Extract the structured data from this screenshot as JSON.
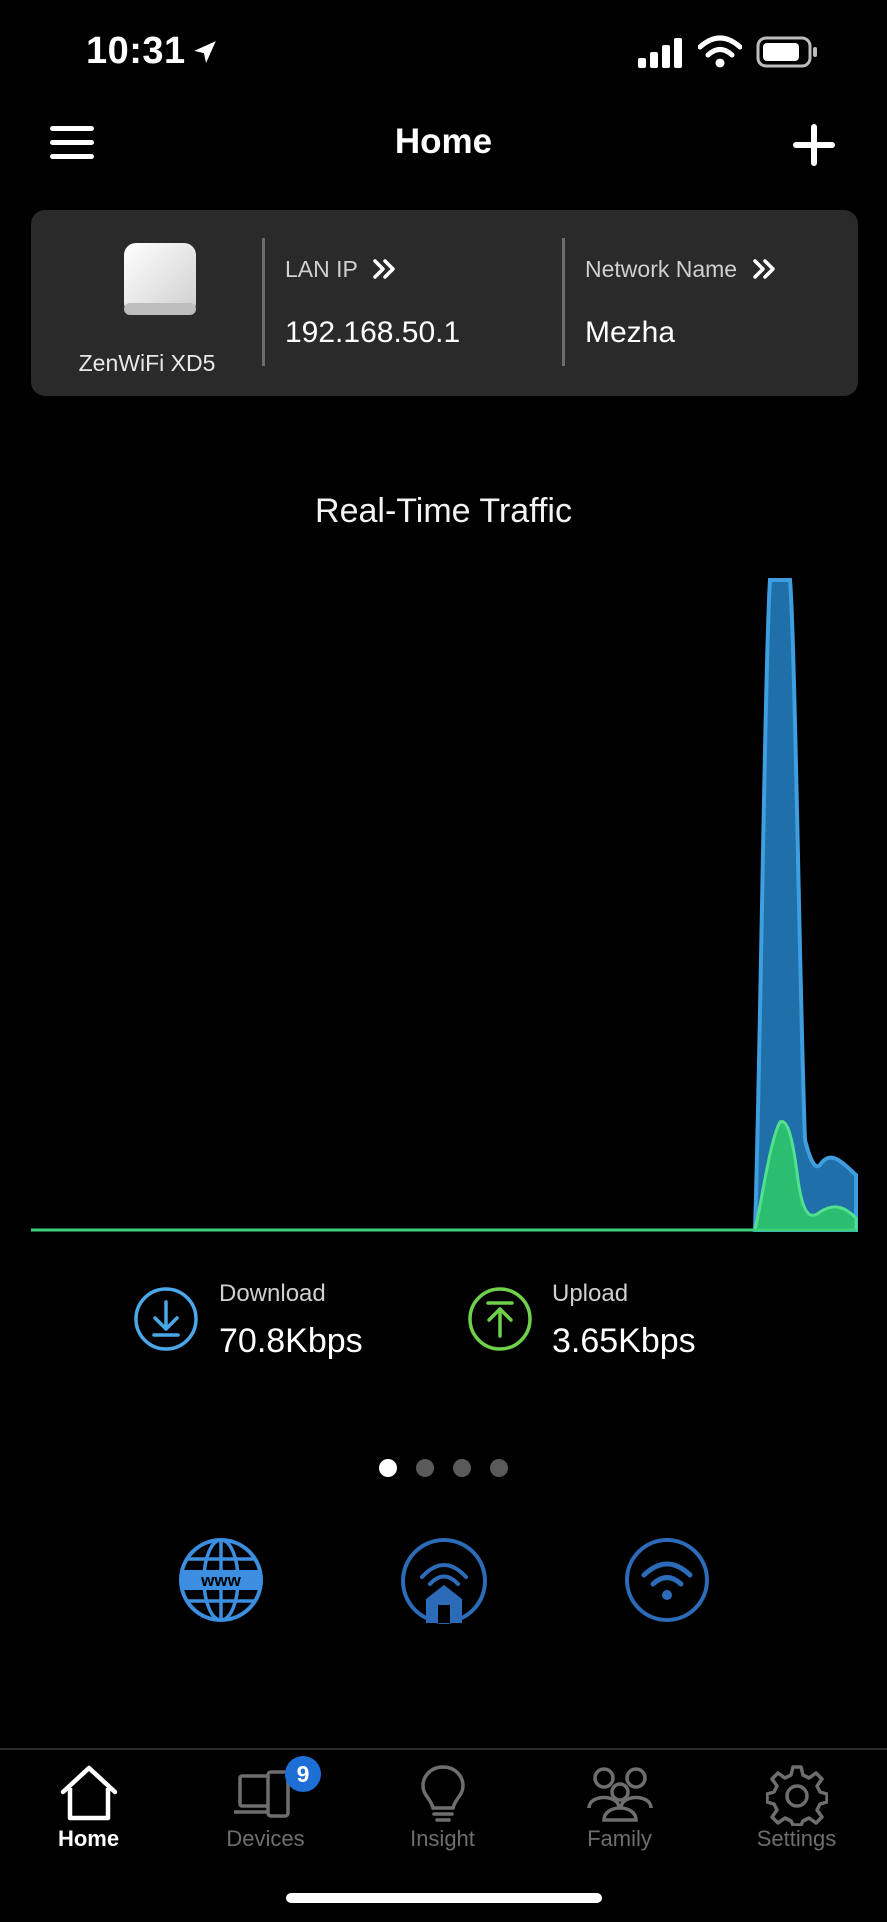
{
  "status_bar": {
    "time": "10:31"
  },
  "header": {
    "title": "Home"
  },
  "router": {
    "model": "ZenWiFi XD5",
    "lan_ip_label": "LAN IP",
    "lan_ip": "192.168.50.1",
    "network_name_label": "Network Name",
    "network_name": "Mezha"
  },
  "traffic": {
    "title": "Real-Time Traffic",
    "download_label": "Download",
    "download_value": "70.8Kbps",
    "upload_label": "Upload",
    "upload_value": "3.65Kbps",
    "download_color": "#1f6fa8",
    "upload_color": "#3ecf7a"
  },
  "pager": {
    "count": 4,
    "active": 1
  },
  "shortcuts": [
    "www-globe-icon",
    "home-network-icon",
    "wifi-icon"
  ],
  "nav": {
    "home": "Home",
    "devices": "Devices",
    "devices_badge": "9",
    "insight": "Insight",
    "family": "Family",
    "settings": "Settings",
    "active": "home"
  }
}
